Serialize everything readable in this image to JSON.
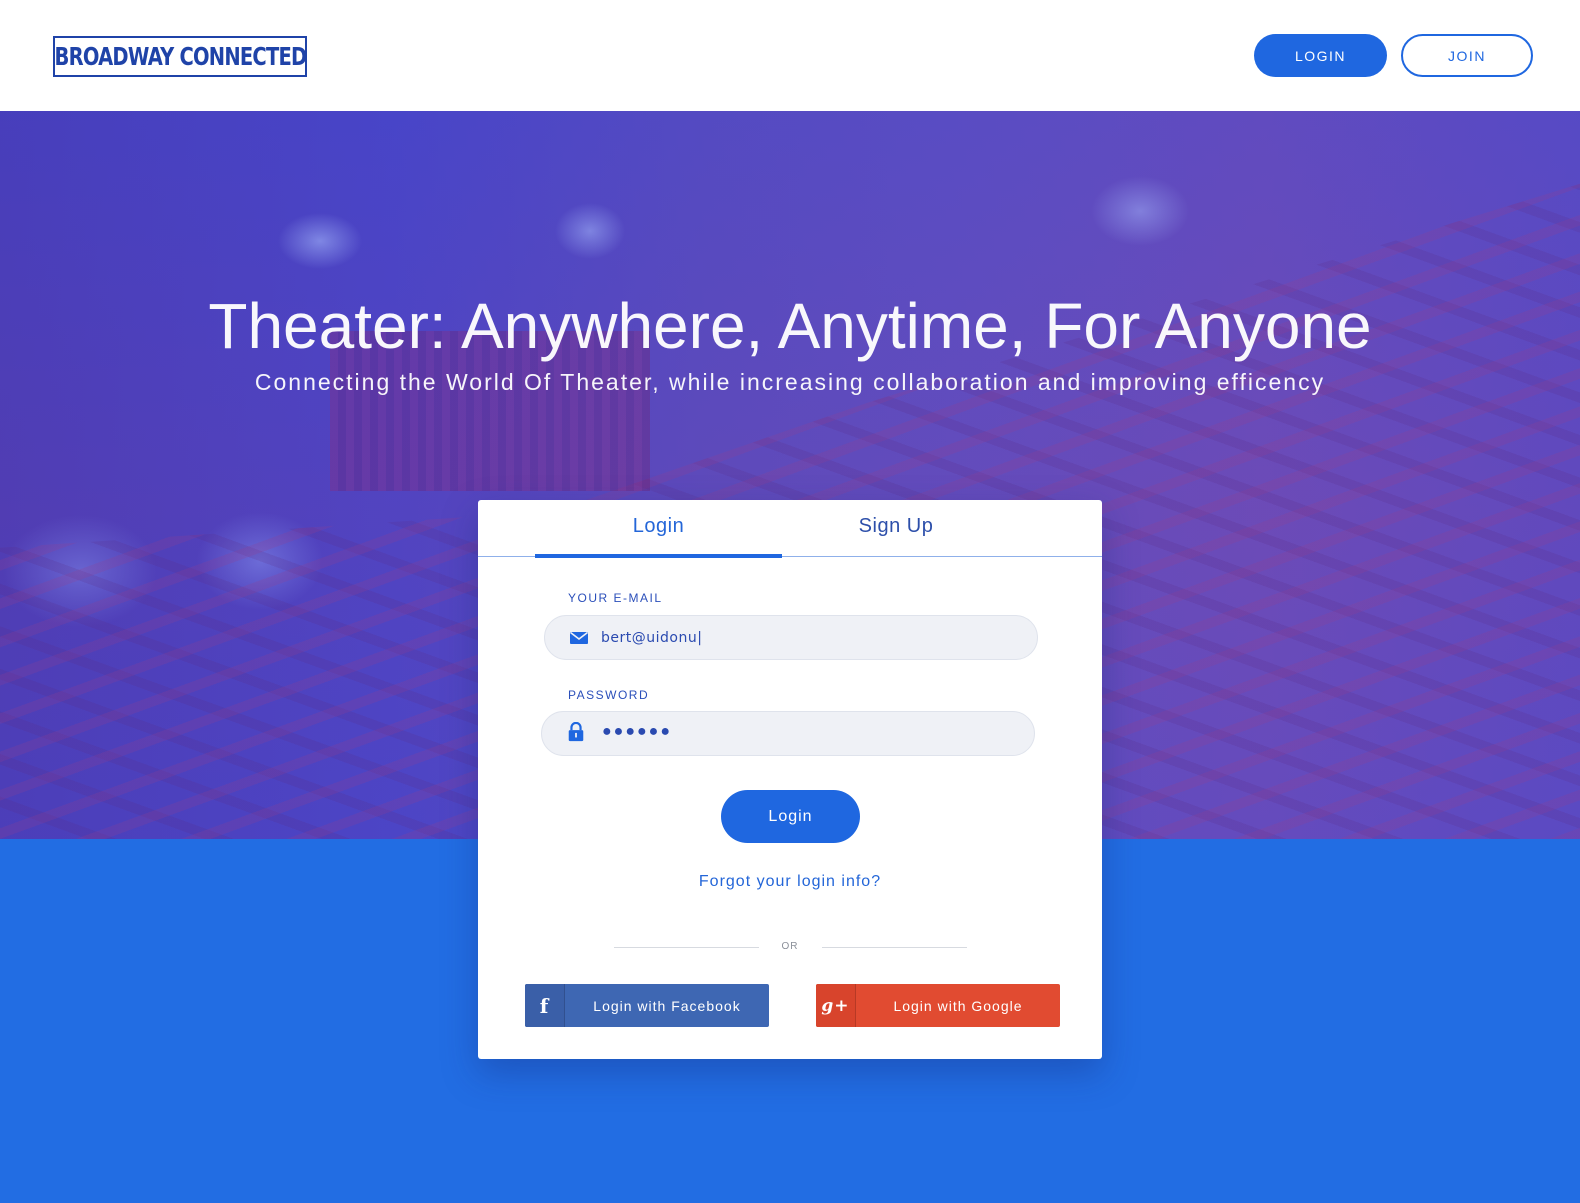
{
  "header": {
    "logo_text": "BROADWAY CONNECTED",
    "login_label": "LOGIN",
    "join_label": "JOIN"
  },
  "hero": {
    "title": "Theater: Anywhere, Anytime, For Anyone",
    "subtitle": "Connecting the World Of Theater, while increasing collaboration and improving efficency"
  },
  "card": {
    "tabs": [
      {
        "label": "Login",
        "active": true
      },
      {
        "label": "Sign Up",
        "active": false
      }
    ],
    "email_label": "YOUR E-MAIL",
    "email_value": "bert@uidonu|",
    "password_label": "PASSWORD",
    "password_value": "●●●●●●",
    "login_button": "Login",
    "forgot_link": "Forgot your login info?",
    "or_text": "OR",
    "facebook_button": "Login with Facebook",
    "google_button": "Login with Google",
    "facebook_icon": "f",
    "google_icon": "g+"
  },
  "colors": {
    "accent": "#1f67e0",
    "page_background": "#226de3",
    "facebook": "#3e67b3",
    "google": "#e14b31"
  },
  "icons": [
    "envelope-icon",
    "lock-icon",
    "facebook-icon",
    "google-plus-icon"
  ]
}
